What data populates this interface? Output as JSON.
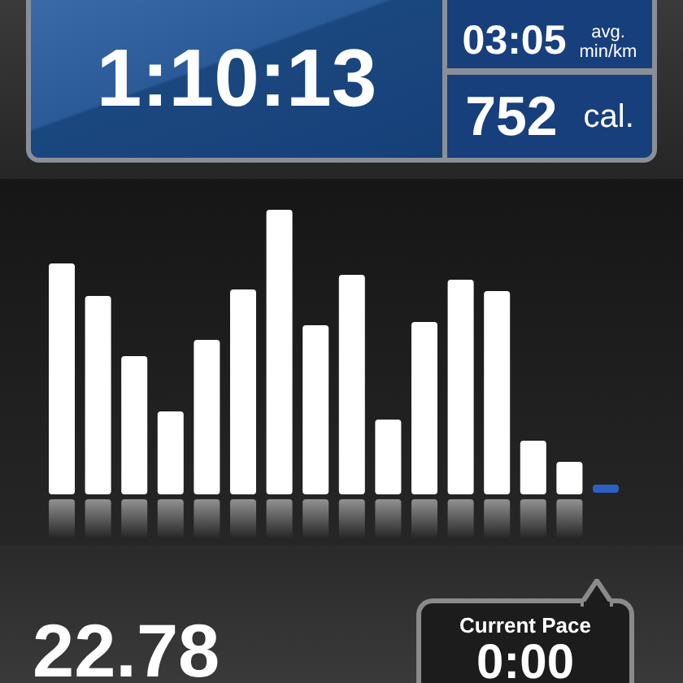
{
  "summary": {
    "elapsed_time": "1:10:13",
    "avg_pace": {
      "value": "03:05",
      "label_top": "avg.",
      "label_bottom": "min/km"
    },
    "calories": {
      "value": "752",
      "unit": "cal."
    }
  },
  "distance": "22.78",
  "current_pace": {
    "label": "Current Pace",
    "value": "0:00"
  }
}
